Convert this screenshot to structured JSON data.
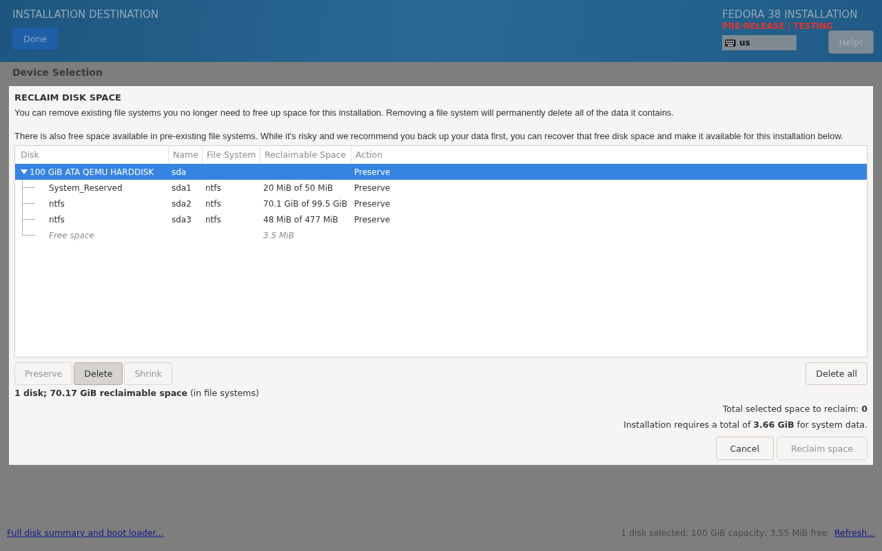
{
  "header": {
    "title": "INSTALLATION DESTINATION",
    "done_button": "Done",
    "product": "FEDORA 38 INSTALLATION",
    "prerelease": "PRE-RELEASE / TESTING",
    "keyboard_layout": "us",
    "help_button": "Help!"
  },
  "section_title": "Device Selection",
  "dialog": {
    "title": "RECLAIM DISK SPACE",
    "intro": "You can remove existing file systems you no longer need to free up space for this installation.  Removing a file system will permanently delete all of the data it contains.",
    "note": "There is also free space available in pre-existing file systems.  While it's risky and we recommend you back up your data first, you can recover that free disk space and make it available for this installation below.",
    "table": {
      "columns": [
        "Disk",
        "Name",
        "File System",
        "Reclaimable Space",
        "Action"
      ],
      "rows": [
        {
          "kind": "disk",
          "expanded": true,
          "selected": true,
          "disk": "100 GiB ATA QEMU HARDDISK",
          "name": "sda",
          "action": "Preserve",
          "children": [
            {
              "kind": "partition",
              "selected": false,
              "disk": "System_Reserved",
              "name": "sda1",
              "file_system": "ntfs",
              "reclaimable": "20 MiB of 50 MiB",
              "action": "Preserve"
            },
            {
              "kind": "partition",
              "selected": false,
              "disk": "ntfs",
              "name": "sda2",
              "file_system": "ntfs",
              "reclaimable": "70.1 GiB of 99.5 GiB",
              "action": "Preserve"
            },
            {
              "kind": "partition",
              "selected": false,
              "disk": "ntfs",
              "name": "sda3",
              "file_system": "ntfs",
              "reclaimable": "48 MiB of 477 MiB",
              "action": "Preserve"
            },
            {
              "kind": "free",
              "selected": false,
              "disk": "Free space",
              "reclaimable": "3.5 MiB"
            }
          ]
        }
      ]
    },
    "action_buttons": [
      {
        "label": "Preserve",
        "disabled": true,
        "pressed": false
      },
      {
        "label": "Delete",
        "disabled": false,
        "pressed": true
      },
      {
        "label": "Shrink",
        "disabled": true,
        "pressed": false
      }
    ],
    "delete_all_button": "Delete all",
    "summary": "**1 disk; 70.17 GiB reclaimable space** (in file systems)",
    "total_selected": "Total selected space to reclaim: **0**",
    "requirement": "Installation requires a total of **3.66 GiB** for system data.",
    "buttons": [
      {
        "label": "Cancel",
        "disabled": false
      },
      {
        "label": "Reclaim space",
        "disabled": true
      }
    ]
  },
  "footer": {
    "summary_link": "Full disk summary and boot loader...",
    "status": "1 disk selected; 100 GiB capacity; 3.55 MiB free",
    "refresh_link": "Refresh..."
  }
}
